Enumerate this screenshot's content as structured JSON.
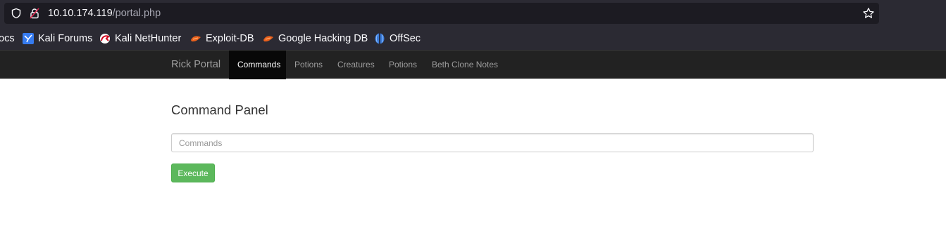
{
  "browser": {
    "url_host": "10.10.174.119",
    "url_path": "/portal.php",
    "bookmarks": [
      {
        "label": "ocs",
        "icon": "docs-icon"
      },
      {
        "label": "Kali Forums",
        "icon": "kali-forums-icon"
      },
      {
        "label": "Kali NetHunter",
        "icon": "kali-nethunter-icon"
      },
      {
        "label": "Exploit-DB",
        "icon": "exploit-db-icon"
      },
      {
        "label": "Google Hacking DB",
        "icon": "exploit-db-icon"
      },
      {
        "label": "OffSec",
        "icon": "offsec-icon"
      }
    ]
  },
  "navbar": {
    "brand": "Rick Portal",
    "items": [
      {
        "label": "Commands",
        "active": true
      },
      {
        "label": "Potions",
        "active": false
      },
      {
        "label": "Creatures",
        "active": false
      },
      {
        "label": "Potions",
        "active": false
      },
      {
        "label": "Beth Clone Notes",
        "active": false
      }
    ]
  },
  "panel": {
    "title": "Command Panel",
    "input_placeholder": "Commands",
    "input_value": "",
    "execute_label": "Execute"
  },
  "colors": {
    "navbar_bg": "#222222",
    "navbar_active_bg": "#080808",
    "button_success": "#5cb85c"
  }
}
